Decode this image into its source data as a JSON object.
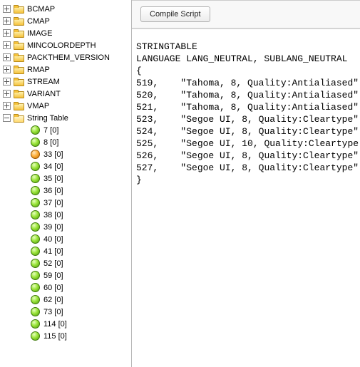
{
  "toolbar": {
    "compile_label": "Compile Script"
  },
  "script_lines": [
    "STRINGTABLE",
    "LANGUAGE LANG_NEUTRAL, SUBLANG_NEUTRAL",
    "{",
    "519, \t\"Tahoma, 8, Quality:Antialiased\"",
    "520, \t\"Tahoma, 8, Quality:Antialiased\"",
    "521, \t\"Tahoma, 8, Quality:Antialiased\"",
    "523, \t\"Segoe UI, 8, Quality:Cleartype\"",
    "524, \t\"Segoe UI, 8, Quality:Cleartype\"",
    "525, \t\"Segoe UI, 10, Quality:Cleartype",
    "526, \t\"Segoe UI, 8, Quality:Cleartype\"",
    "527, \t\"Segoe UI, 8, Quality:Cleartype\"",
    "}"
  ],
  "tree": {
    "folders": [
      {
        "label": "BCMAP"
      },
      {
        "label": "CMAP"
      },
      {
        "label": "IMAGE"
      },
      {
        "label": "MINCOLORDEPTH"
      },
      {
        "label": "PACKTHEM_VERSION"
      },
      {
        "label": "RMAP"
      },
      {
        "label": "STREAM"
      },
      {
        "label": "VARIANT"
      },
      {
        "label": "VMAP"
      }
    ],
    "open_folder": {
      "label": "String Table"
    },
    "items": [
      {
        "label": "7 [0]",
        "color": "green"
      },
      {
        "label": "8 [0]",
        "color": "green"
      },
      {
        "label": "33 [0]",
        "color": "orange"
      },
      {
        "label": "34 [0]",
        "color": "green"
      },
      {
        "label": "35 [0]",
        "color": "green"
      },
      {
        "label": "36 [0]",
        "color": "green"
      },
      {
        "label": "37 [0]",
        "color": "green"
      },
      {
        "label": "38 [0]",
        "color": "green"
      },
      {
        "label": "39 [0]",
        "color": "green"
      },
      {
        "label": "40 [0]",
        "color": "green"
      },
      {
        "label": "41 [0]",
        "color": "green"
      },
      {
        "label": "52 [0]",
        "color": "green"
      },
      {
        "label": "59 [0]",
        "color": "green"
      },
      {
        "label": "60 [0]",
        "color": "green"
      },
      {
        "label": "62 [0]",
        "color": "green"
      },
      {
        "label": "73 [0]",
        "color": "green"
      },
      {
        "label": "114 [0]",
        "color": "green"
      },
      {
        "label": "115 [0]",
        "color": "green"
      }
    ]
  }
}
